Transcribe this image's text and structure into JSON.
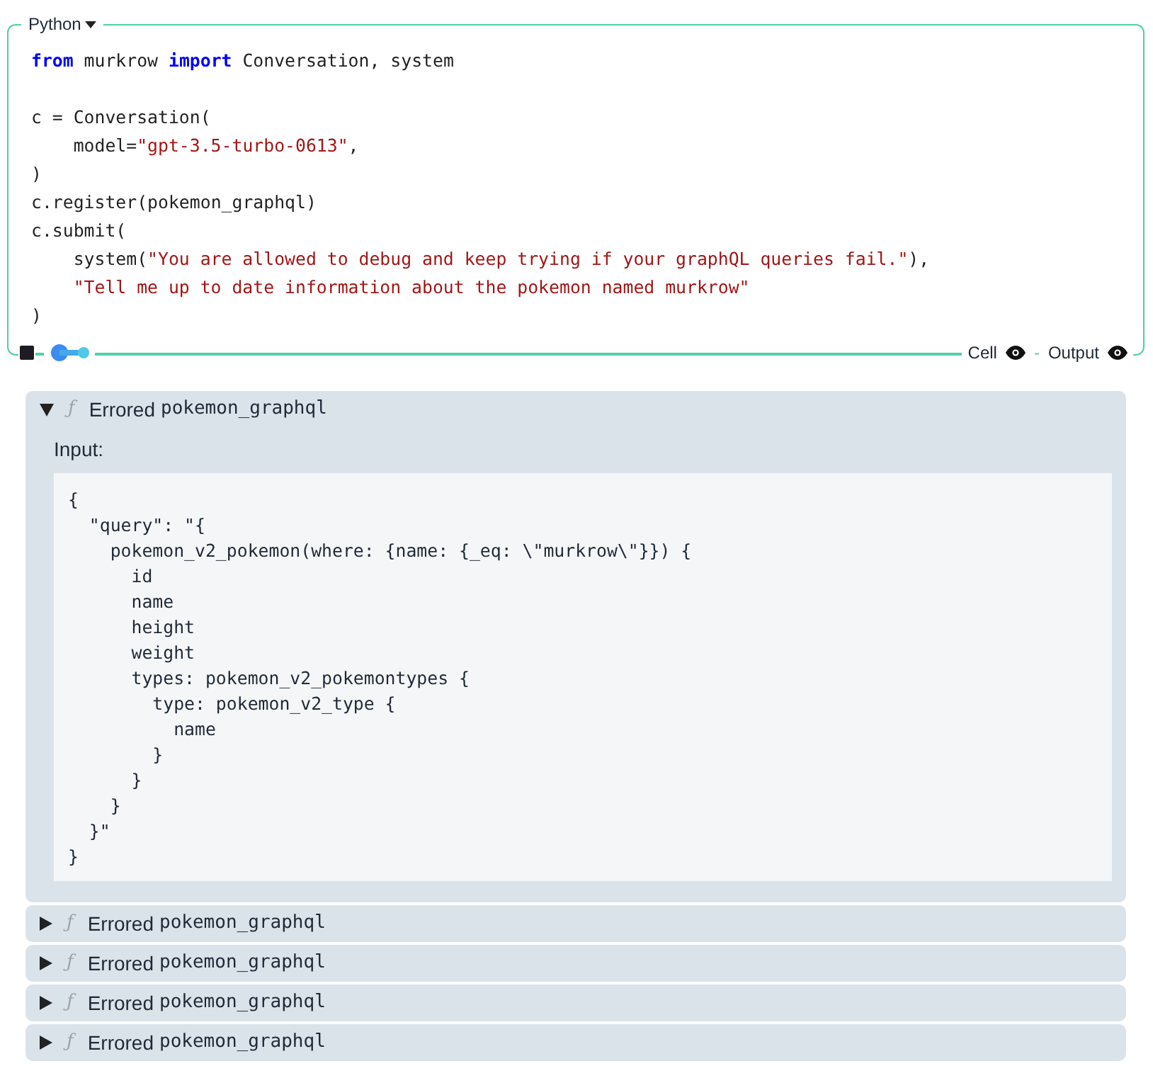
{
  "cell": {
    "language": "Python",
    "code": [
      {
        "kind": "line",
        "tokens": [
          {
            "kind": "keyword",
            "text": "from"
          },
          {
            "kind": "plain",
            "text": " murkrow "
          },
          {
            "kind": "keyword",
            "text": "import"
          },
          {
            "kind": "plain",
            "text": " Conversation, system"
          }
        ]
      },
      {
        "kind": "blank"
      },
      {
        "kind": "line",
        "tokens": [
          {
            "kind": "plain",
            "text": "c = Conversation("
          }
        ]
      },
      {
        "kind": "indented",
        "tokens": [
          {
            "kind": "plain",
            "text": "model="
          },
          {
            "kind": "string",
            "text": "\"gpt-3.5-turbo-0613\""
          },
          {
            "kind": "plain",
            "text": ","
          }
        ]
      },
      {
        "kind": "line",
        "tokens": [
          {
            "kind": "plain",
            "text": ")"
          }
        ]
      },
      {
        "kind": "line",
        "tokens": [
          {
            "kind": "plain",
            "text": "c.register(pokemon_graphql)"
          }
        ]
      },
      {
        "kind": "line",
        "tokens": [
          {
            "kind": "plain",
            "text": "c.submit("
          }
        ]
      },
      {
        "kind": "indented",
        "tokens": [
          {
            "kind": "plain",
            "text": "system("
          },
          {
            "kind": "string",
            "text": "\"You are allowed to debug and keep trying if your graphQL queries fail.\""
          },
          {
            "kind": "plain",
            "text": "),"
          }
        ]
      },
      {
        "kind": "indented",
        "tokens": [
          {
            "kind": "string",
            "text": "\"Tell me up to date information about the pokemon named murkrow\""
          }
        ]
      },
      {
        "kind": "line",
        "tokens": [
          {
            "kind": "plain",
            "text": ")"
          }
        ]
      }
    ],
    "toggles": [
      {
        "label": "Cell",
        "visible": true
      },
      {
        "label": "Output",
        "visible": true
      }
    ],
    "separator": "-"
  },
  "calls": [
    {
      "expanded": true,
      "symbol": "ƒ",
      "status": "Errored",
      "name": "pokemon_graphql",
      "input_label": "Input:",
      "input": [
        "{",
        "  \"query\": \"{",
        "    pokemon_v2_pokemon(where: {name: {_eq: \\\"murkrow\\\"}}) {",
        "      id",
        "      name",
        "      height",
        "      weight",
        "      types: pokemon_v2_pokemontypes {",
        "        type: pokemon_v2_type {",
        "          name",
        "        }",
        "      }",
        "    }",
        "  }\"",
        "}"
      ]
    },
    {
      "expanded": false,
      "symbol": "ƒ",
      "status": "Errored",
      "name": "pokemon_graphql"
    },
    {
      "expanded": false,
      "symbol": "ƒ",
      "status": "Errored",
      "name": "pokemon_graphql"
    },
    {
      "expanded": false,
      "symbol": "ƒ",
      "status": "Errored",
      "name": "pokemon_graphql"
    },
    {
      "expanded": false,
      "symbol": "ƒ",
      "status": "Errored",
      "name": "pokemon_graphql"
    }
  ]
}
